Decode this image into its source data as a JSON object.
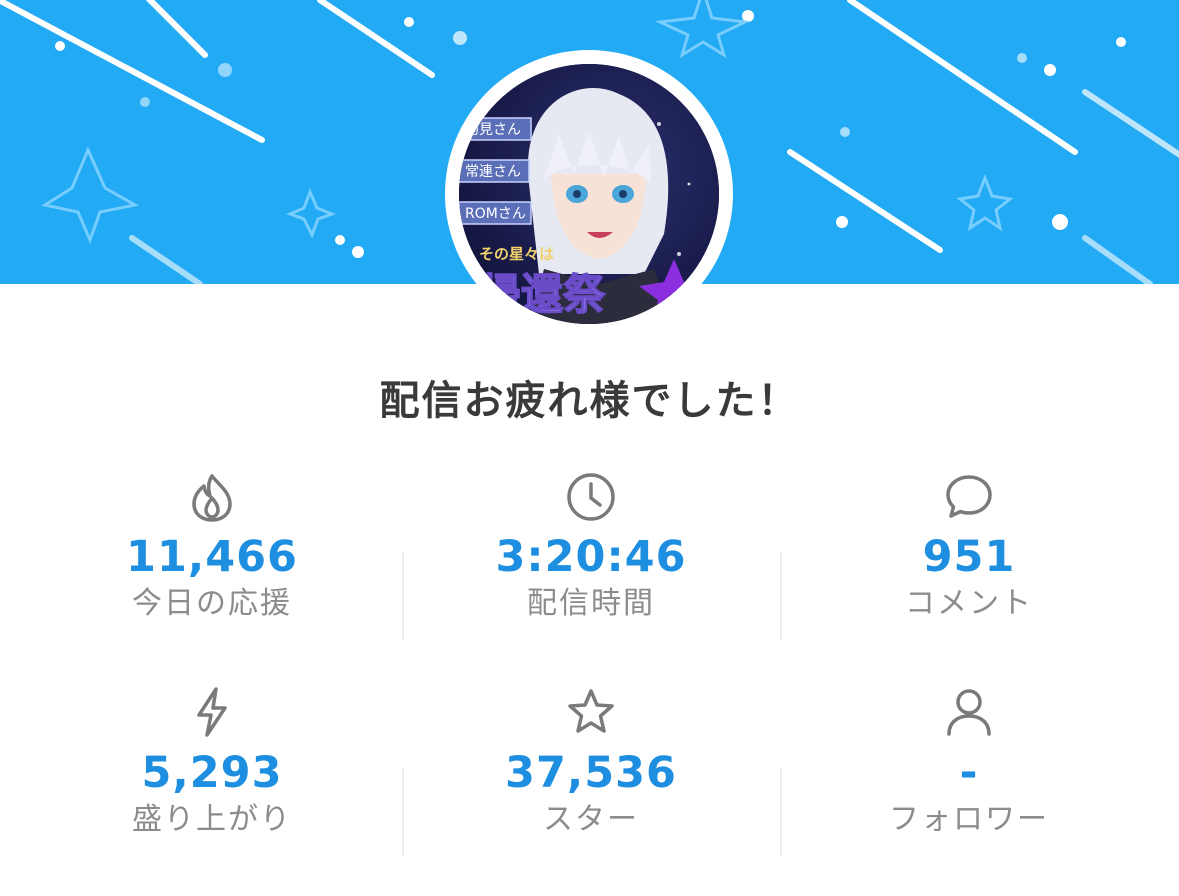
{
  "header": {
    "banner_color": "#22aaf5",
    "avatar": {
      "badges": [
        "初見さん",
        "常連さん",
        "ROMさん"
      ],
      "caption": "その星々は",
      "logo_text": "帰還祭"
    }
  },
  "title": "配信お疲れ様でした！",
  "accent_color": "#1e8fe0",
  "stats": [
    {
      "icon": "flame-icon",
      "value": "11,466",
      "label": "今日の応援"
    },
    {
      "icon": "clock-icon",
      "value": "3:20:46",
      "label": "配信時間"
    },
    {
      "icon": "comment-icon",
      "value": "951",
      "label": "コメント"
    },
    {
      "icon": "lightning-icon",
      "value": "5,293",
      "label": "盛り上がり"
    },
    {
      "icon": "star-icon",
      "value": "37,536",
      "label": "スター"
    },
    {
      "icon": "person-icon",
      "value": "-",
      "label": "フォロワー"
    }
  ]
}
